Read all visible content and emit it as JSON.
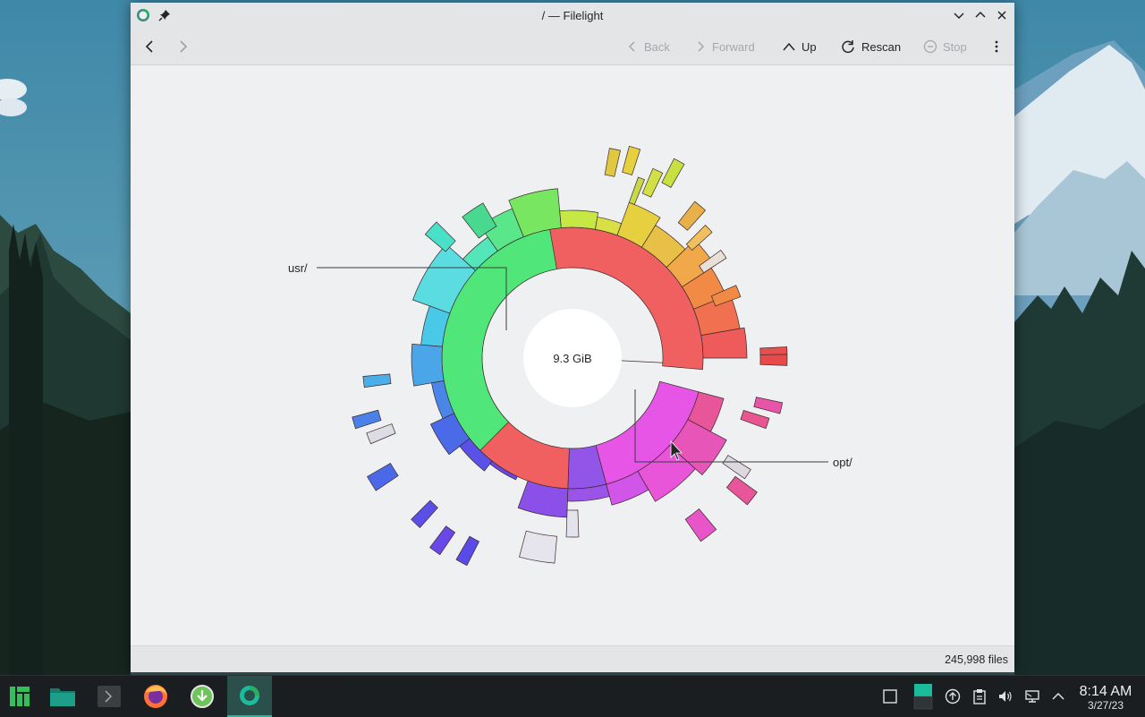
{
  "window": {
    "title": "/ — Filelight"
  },
  "toolbar": {
    "back_label": "Back",
    "forward_label": "Forward",
    "up_label": "Up",
    "rescan_label": "Rescan",
    "stop_label": "Stop"
  },
  "chart": {
    "center_label": "9.3 GiB",
    "callout_usr": "usr/",
    "callout_opt": "opt/"
  },
  "status": {
    "files": "245,998 files"
  },
  "clock": {
    "time": "8:14 AM",
    "date": "3/27/23"
  },
  "taskbar": {
    "items": [
      "manjaro-menu-icon",
      "file-manager-icon",
      "terminal-icon",
      "firefox-icon",
      "downloader-icon",
      "filelight-icon"
    ]
  },
  "colors": {
    "accent": "#1abc9c",
    "root_ring": "#f05a5a"
  }
}
